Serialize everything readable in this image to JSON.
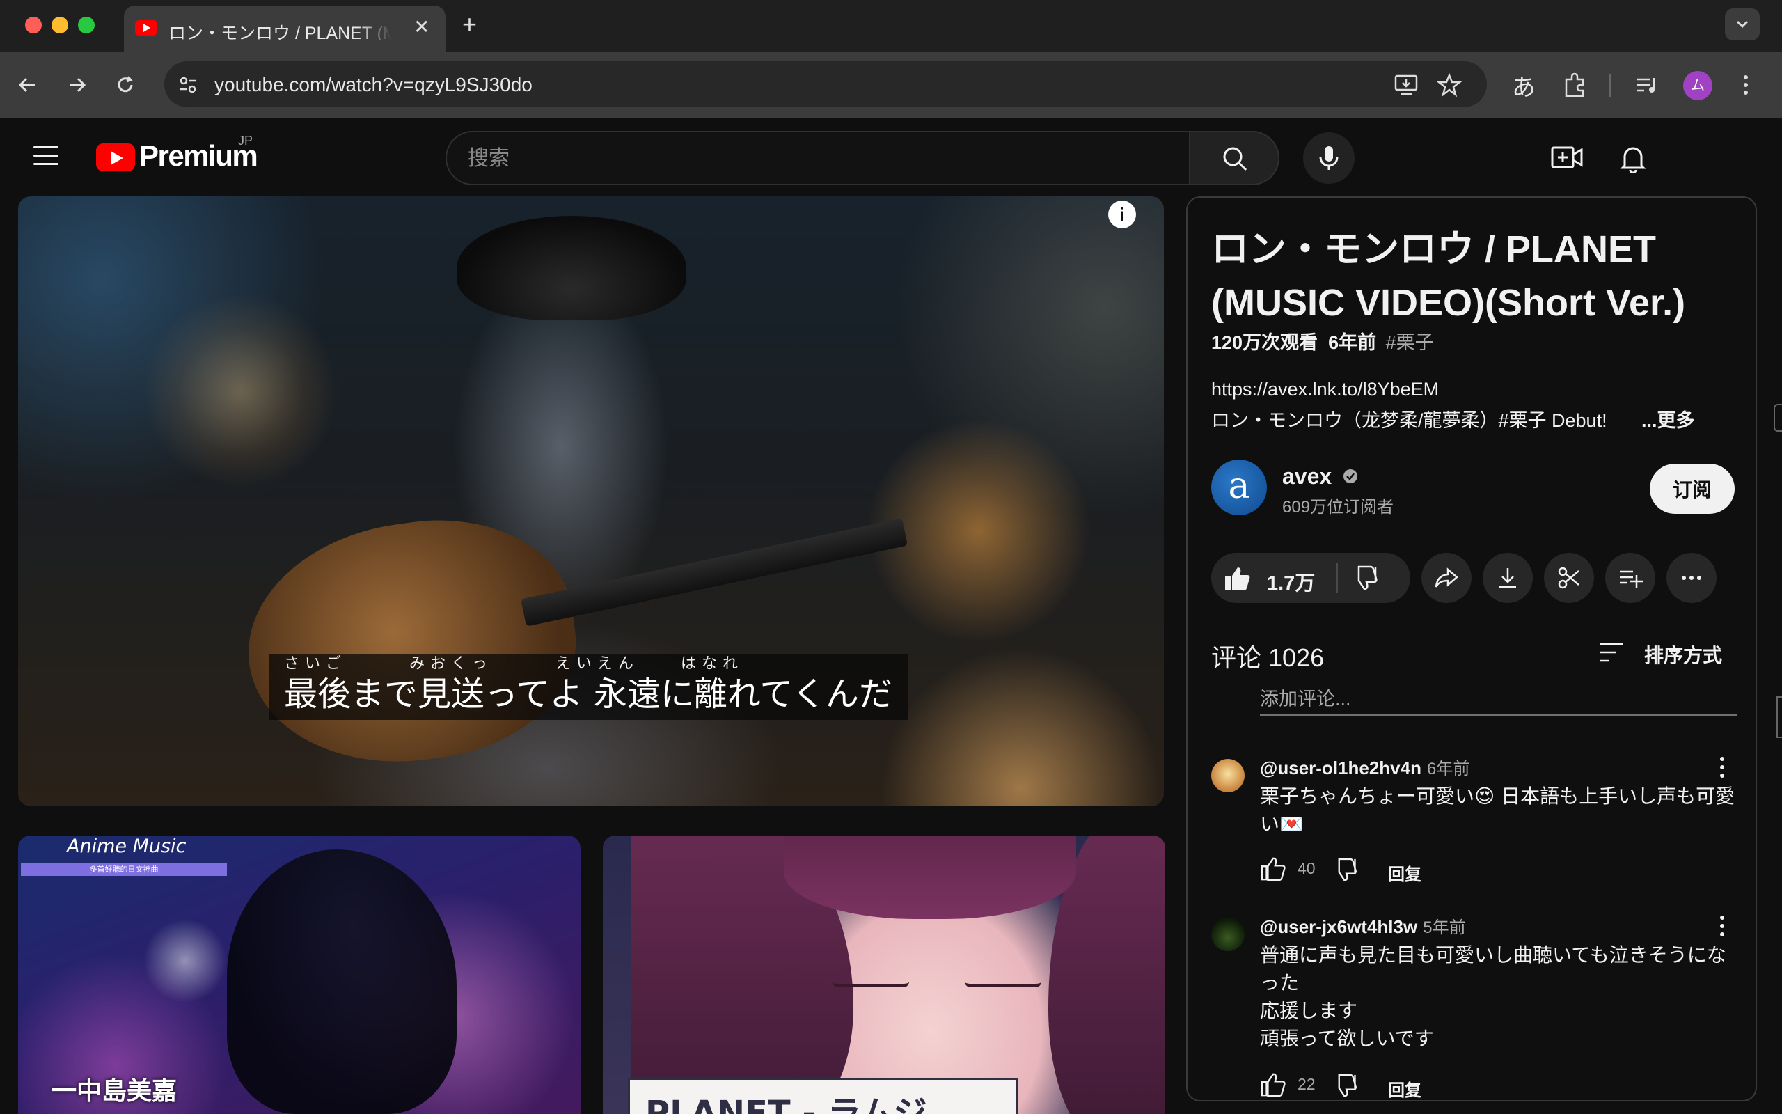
{
  "browser": {
    "tab_title": "ロン・モンロウ / PLANET (MUSIC VIDEO)(Short Ver.)",
    "url": "youtube.com/watch?v=qzyL9SJ30do",
    "ime_label": "あ",
    "profile_initial": "ム"
  },
  "masthead": {
    "logo_text": "Premium",
    "region": "JP",
    "search_placeholder": "搜索"
  },
  "player": {
    "caption_ruby": "さいご      みおくっ      えいえん    はなれ",
    "caption_line": "最後まで見送ってよ 永遠に離れてくんだ",
    "info_glyph": "i"
  },
  "recommendations": [
    {
      "badge": "Anime Music",
      "subtitle": "多首好聽的日文神曲",
      "artist": "一中島美嘉"
    },
    {
      "title": "PLANET - ラムジ"
    }
  ],
  "video": {
    "title": "ロン・モンロウ / PLANET (MUSIC VIDEO)(Short Ver.)",
    "views": "120万次观看",
    "age": "6年前",
    "hashtag": "#栗子",
    "description_link": "https://avex.lnk.to/l8YbeEM",
    "description_line": "ロン・モンロウ（龙梦柔/龍夢柔）#栗子 Debut!",
    "more_label": "...更多"
  },
  "channel": {
    "name": "avex",
    "avatar_letter": "a",
    "subscribers": "609万位订阅者",
    "subscribe_label": "订阅"
  },
  "actions": {
    "like_count": "1.7万"
  },
  "comments": {
    "header": "评论 1026",
    "sort_label": "排序方式",
    "add_placeholder": "添加评论...",
    "reply_label": "回复",
    "items": [
      {
        "author": "@user-ol1he2hv4n",
        "time": "6年前",
        "text": "栗子ちゃんちょー可愛い😍 日本語も上手いし声も可愛い💌",
        "likes": "40"
      },
      {
        "author": "@user-jx6wt4hl3w",
        "time": "5年前",
        "text_lines": [
          "普通に声も見た目も可愛いし曲聴いても泣きそうになった",
          "応援します",
          "頑張って欲しいです"
        ],
        "likes": "22"
      }
    ]
  },
  "colors": {
    "youtube_red": "#ff0000",
    "background": "#0f0f0f",
    "pill": "#272727",
    "secondary_text": "#aaaaaa",
    "profile": "#a142c4"
  }
}
